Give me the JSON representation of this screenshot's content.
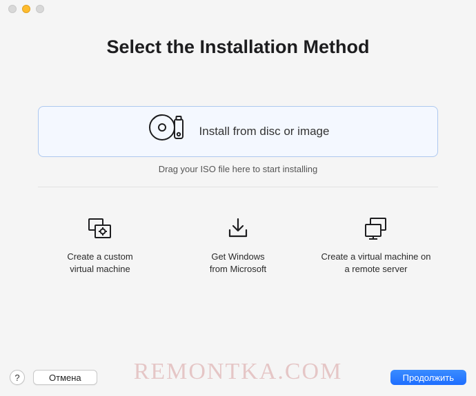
{
  "header": {
    "title": "Select the Installation Method"
  },
  "dropzone": {
    "label": "Install from disc or image",
    "hint": "Drag your ISO file here to start installing"
  },
  "options": {
    "custom": {
      "label": "Create a custom\nvirtual machine"
    },
    "windows": {
      "label": "Get Windows\nfrom Microsoft"
    },
    "remote": {
      "label": "Create a virtual machine on\na remote server"
    }
  },
  "footer": {
    "help": "?",
    "cancel": "Отмена",
    "continue": "Продолжить"
  },
  "watermark": "REMONTKA.COM"
}
